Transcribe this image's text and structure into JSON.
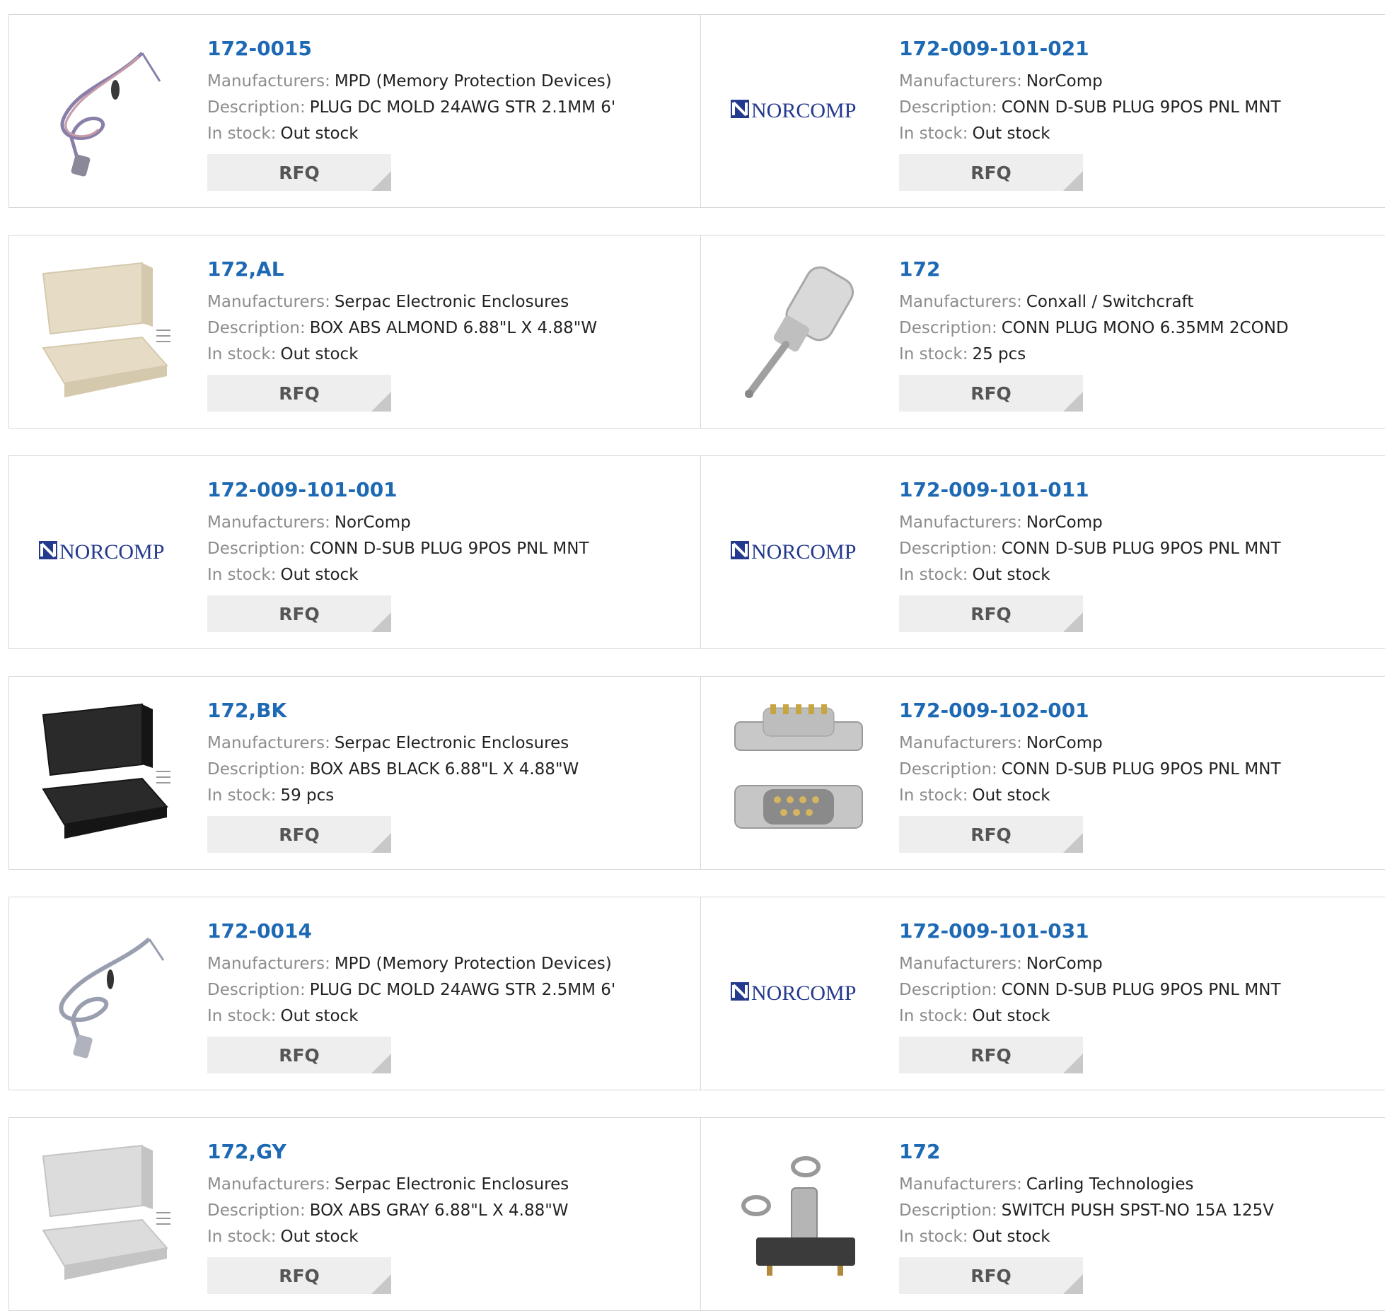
{
  "rows": [
    {
      "left": {
        "pn": "172-0015",
        "manufacturer": "MPD (Memory Protection Devices)",
        "description": "PLUG DC MOLD 24AWG STR 2.1MM 6'",
        "stock": "Out stock",
        "icon": "cable-red-icon"
      },
      "right": {
        "pn": "172-009-101-021",
        "manufacturer": "NorComp",
        "description": "CONN D-SUB PLUG 9POS PNL MNT",
        "stock": "Out stock",
        "icon": "norcomp-logo"
      }
    },
    {
      "left": {
        "pn": "172,AL",
        "manufacturer": "Serpac Electronic Enclosures",
        "description": "BOX ABS ALMOND 6.88\"L X 4.88\"W",
        "stock": "Out stock",
        "icon": "enclosure-almond-icon"
      },
      "right": {
        "pn": "172",
        "manufacturer": "Conxall / Switchcraft",
        "description": "CONN PLUG MONO 6.35MM 2COND",
        "stock": "25 pcs",
        "icon": "jack-plug-icon"
      }
    },
    {
      "left": {
        "pn": "172-009-101-001",
        "manufacturer": "NorComp",
        "description": "CONN D-SUB PLUG 9POS PNL MNT",
        "stock": "Out stock",
        "icon": "norcomp-logo"
      },
      "right": {
        "pn": "172-009-101-011",
        "manufacturer": "NorComp",
        "description": "CONN D-SUB PLUG 9POS PNL MNT",
        "stock": "Out stock",
        "icon": "norcomp-logo"
      }
    },
    {
      "left": {
        "pn": "172,BK",
        "manufacturer": "Serpac Electronic Enclosures",
        "description": "BOX ABS BLACK 6.88\"L X 4.88\"W",
        "stock": "59 pcs",
        "icon": "enclosure-black-icon"
      },
      "right": {
        "pn": "172-009-102-001",
        "manufacturer": "NorComp",
        "description": "CONN D-SUB PLUG 9POS PNL MNT",
        "stock": "Out stock",
        "icon": "dsub-connector-icon"
      }
    },
    {
      "left": {
        "pn": "172-0014",
        "manufacturer": "MPD (Memory Protection Devices)",
        "description": "PLUG DC MOLD 24AWG STR 2.5MM 6'",
        "stock": "Out stock",
        "icon": "cable-gray-icon"
      },
      "right": {
        "pn": "172-009-101-031",
        "manufacturer": "NorComp",
        "description": "CONN D-SUB PLUG 9POS PNL MNT",
        "stock": "Out stock",
        "icon": "norcomp-logo"
      }
    },
    {
      "left": {
        "pn": "172,GY",
        "manufacturer": "Serpac Electronic Enclosures",
        "description": "BOX ABS GRAY 6.88\"L X 4.88\"W",
        "stock": "Out stock",
        "icon": "enclosure-gray-icon"
      },
      "right": {
        "pn": "172",
        "manufacturer": "Carling Technologies",
        "description": "SWITCH PUSH SPST-NO 15A 125V",
        "stock": "Out stock",
        "icon": "push-switch-icon"
      }
    }
  ],
  "labels": {
    "manufacturer": "Manufacturers:",
    "description": "Description:",
    "stock": "In stock:",
    "rfq": "RFQ",
    "norcomp_logo": "NORCOMP"
  },
  "colors": {
    "part_number": "#1e69b4",
    "label": "#8c8c8c",
    "value": "#222222",
    "border": "#d7d7d7",
    "rfq_bg": "#eeeeee"
  }
}
